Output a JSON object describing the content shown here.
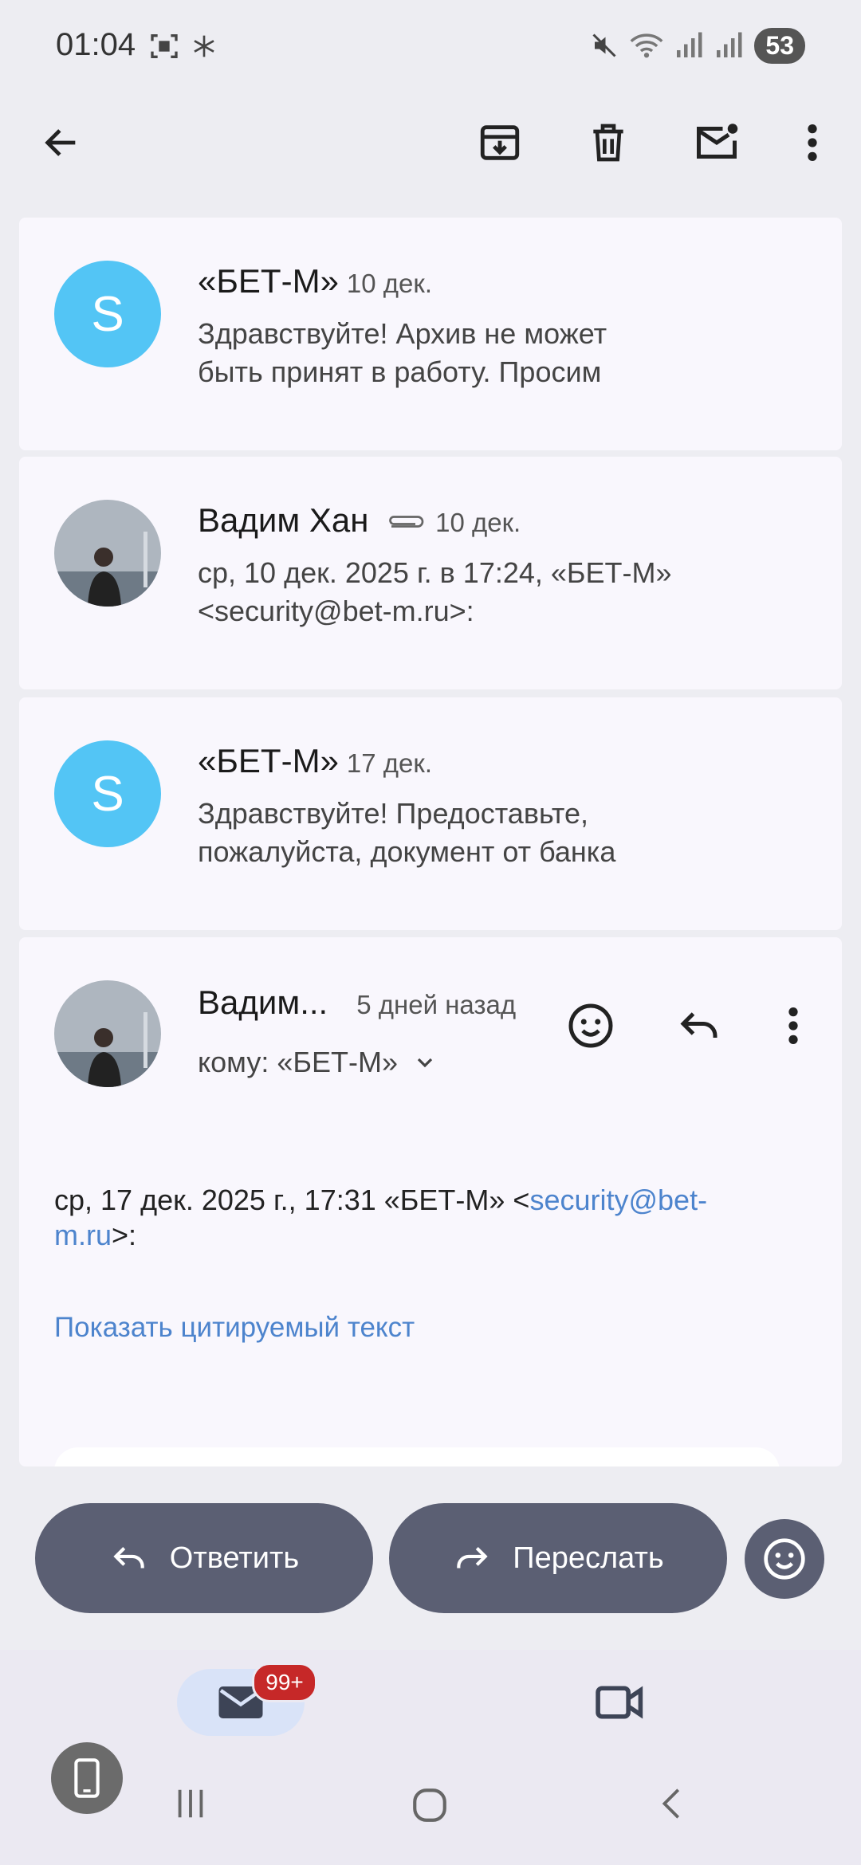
{
  "status_bar": {
    "time": "01:04",
    "battery": "53"
  },
  "app_bar": {
    "back_icon": "arrow-left-icon",
    "archive_icon": "archive-icon",
    "delete_icon": "trash-icon",
    "mark_unread_icon": "mail-unread-icon",
    "more_icon": "more-vertical-icon"
  },
  "thread": [
    {
      "avatar_letter": "S",
      "sender": "«БЕТ-М»",
      "date": "10 дек.",
      "snippet_line1": "Здравствуйте! Архив не может",
      "snippet_line2": "быть принят в работу. Просим"
    },
    {
      "sender": "Вадим Хан",
      "date": "10 дек.",
      "snippet_line1": "ср, 10 дек. 2025 г. в 17:24, «БЕТ-М»",
      "snippet_line2": "<security@bet-m.ru>:"
    },
    {
      "avatar_letter": "S",
      "sender": "«БЕТ-М»",
      "date": "17 дек.",
      "snippet_line1": "Здравствуйте! Предоставьте,",
      "snippet_line2": "пожалуйста, документ от банка"
    }
  ],
  "open_message": {
    "sender": "Вадим...",
    "date": "5 дней назад",
    "recipient": "кому: «БЕТ-М»",
    "quote_header_start": "ср, 17 дек. 2025 г., 17:31 «БЕТ-М» <",
    "quote_email_part1": "security@bet-",
    "quote_email_part2": "m.ru",
    "quote_header_end": ">:",
    "show_quoted": "Показать цитируемый текст"
  },
  "actions": {
    "reply": "Ответить",
    "forward": "Переслать"
  },
  "bottom_nav": {
    "mail_badge": "99+"
  },
  "colors": {
    "accent": "#53c5f5",
    "link": "#4d84cd",
    "pill": "#5b5f73",
    "badge": "#c62828"
  }
}
